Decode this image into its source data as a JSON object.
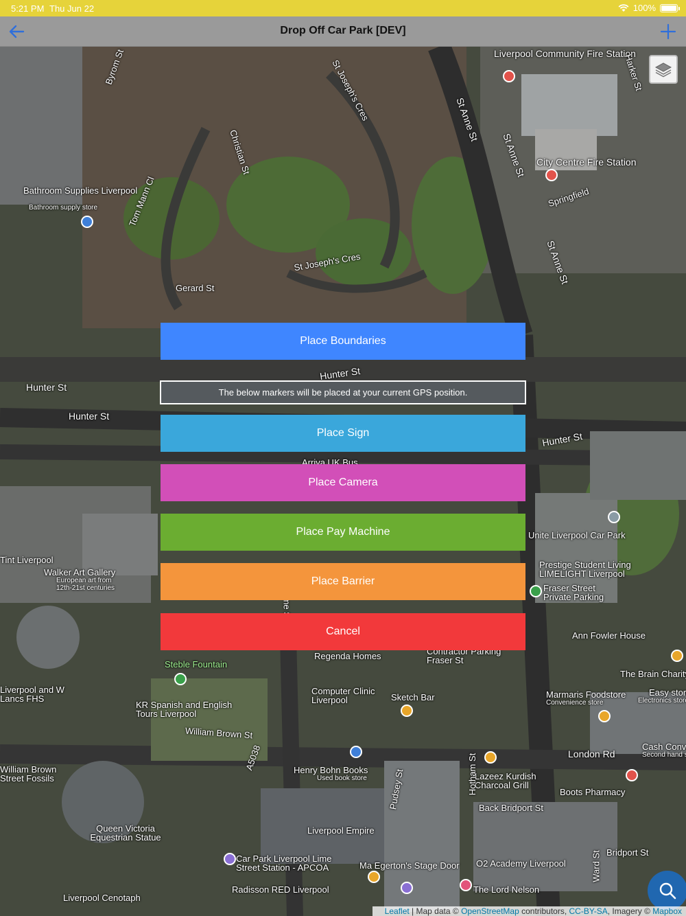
{
  "status_bar": {
    "time": "5:21 PM",
    "date": "Thu Jun 22",
    "battery": "100%"
  },
  "nav": {
    "title": "Drop Off Car Park [DEV]"
  },
  "map": {
    "labels": [
      "Liverpool Community Fire Station",
      "City Centre Fire Station",
      "Springfield",
      "Bathroom Supplies Liverpool",
      "Bathroom supply store",
      "Hunter St",
      "Hunter St",
      "Hunter St",
      "Hunter St",
      "Arriva UK Bus",
      "Unite Liverpool Car Park",
      "Prestige Student Living LIMELIGHT Liverpool",
      "Fraser Street Private Parking",
      "Ann Fowler House",
      "The Brain Charity",
      "Marmaris Foodstore",
      "Convenience store",
      "Easy store",
      "Electronics store",
      "Walker Art Gallery",
      "European art from 12th-21st centuries",
      "Tint Liverpool",
      "Steble Fountain",
      "Regenda Homes",
      "Contractor Parking Fraser St",
      "Computer Clinic Liverpool",
      "Sketch Bar",
      "KR Spanish and English Tours Liverpool",
      "William Brown St",
      "Liverpool and W Lancs FHS",
      "Henry Bohn Books",
      "Used book store",
      "Lazeez Kurdish Charcoal Grill",
      "Boots Pharmacy",
      "London Rd",
      "Cash Converters",
      "Second hand store",
      "Back Bridport St",
      "Bridport St",
      "Liverpool Empire",
      "Queen Victoria Equestrian Statue",
      "Car Park Liverpool Lime Street Station - APCOA",
      "Ma Egerton's Stage Door",
      "O2 Academy Liverpool",
      "Radisson RED Liverpool",
      "The Lord Nelson",
      "Liverpool Cenotaph",
      "William Brown Street Fossils",
      "St Anne St",
      "St Anne St",
      "St Anne St",
      "St Joseph's Cres",
      "St Joseph's Cres",
      "Christian St",
      "Tom Mann Cl",
      "Gerard St",
      "Byrom St",
      "Harker St",
      "Lime St",
      "Hotham St",
      "Pudsey St",
      "A5038",
      "Ward St"
    ]
  },
  "actions": {
    "place_boundaries": "Place Boundaries",
    "info": "The below markers will be placed at your current GPS position.",
    "place_sign": "Place Sign",
    "place_camera": "Place Camera",
    "place_pay_machine": "Place Pay Machine",
    "place_barrier": "Place Barrier",
    "cancel": "Cancel"
  },
  "colors": {
    "boundaries": "#3f86ff",
    "sign": "#3aa7db",
    "camera": "#d24fb8",
    "pay_machine": "#6bad31",
    "barrier": "#f4953c",
    "cancel": "#f2393b",
    "nav_icon": "#2f6fdb"
  },
  "attribution": {
    "leaflet": "Leaflet",
    "map_data": "Map data ©",
    "osm": "OpenStreetMap",
    "contributors": "contributors,",
    "license": "CC-BY-SA",
    "imagery": ", Imagery ©",
    "mapbox": "Mapbox"
  }
}
